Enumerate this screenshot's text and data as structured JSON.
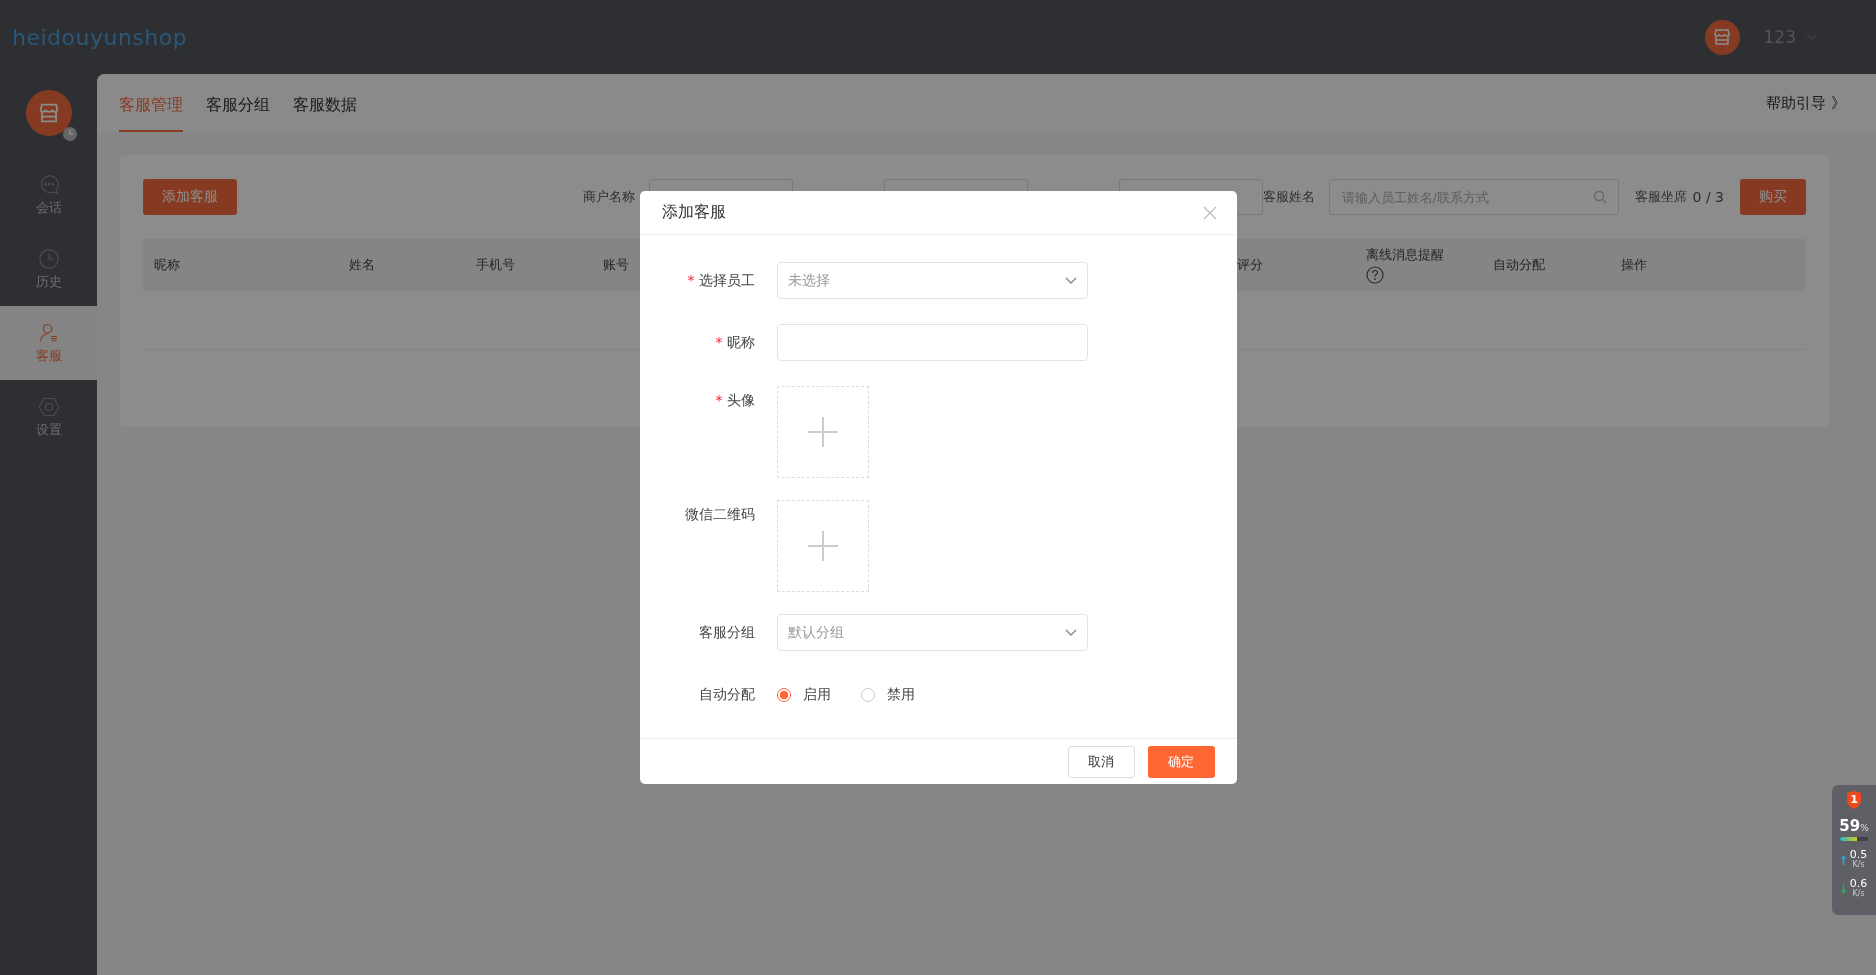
{
  "header": {
    "logo": "heidouyunshop",
    "user": "123"
  },
  "sidebar": [
    {
      "label": "会话",
      "selected": false
    },
    {
      "label": "历史",
      "selected": false
    },
    {
      "label": "客服",
      "selected": true
    },
    {
      "label": "设置",
      "selected": false
    }
  ],
  "tabs": [
    {
      "label": "客服管理",
      "selected": true
    },
    {
      "label": "客服分组",
      "selected": false
    },
    {
      "label": "客服数据",
      "selected": false
    }
  ],
  "help_link": "帮助引导 》",
  "toolbar": {
    "add_button": "添加客服",
    "merchant_label": "商户名称",
    "name_label": "客服姓名",
    "search_placeholder": "请输入员工姓名/联系方式",
    "seats_label": "客服坐席",
    "seats_count": "0 / 3",
    "buy_button": "购买"
  },
  "table": {
    "columns": [
      {
        "label": "昵称",
        "help": false
      },
      {
        "label": "姓名",
        "help": false
      },
      {
        "label": "手机号",
        "help": false
      },
      {
        "label": "账号",
        "help": false
      },
      {
        "label": "评分",
        "help": false
      },
      {
        "label": "离线消息提醒",
        "help": true
      },
      {
        "label": "自动分配",
        "help": false
      },
      {
        "label": "操作",
        "help": false
      }
    ]
  },
  "dialog": {
    "title": "添加客服",
    "fields": [
      {
        "kind": "select",
        "required_mark": "*",
        "label": "选择员工",
        "placeholder": "未选择"
      },
      {
        "kind": "text",
        "required_mark": "*",
        "label": "昵称"
      },
      {
        "kind": "upload",
        "required_mark": "*",
        "label": "头像"
      },
      {
        "kind": "upload",
        "label": "微信二维码"
      },
      {
        "kind": "select",
        "label": "客服分组",
        "placeholder": "默认分组"
      },
      {
        "kind": "radio",
        "label": "自动分配",
        "options": [
          {
            "label": "启用",
            "selected": true
          },
          {
            "label": "禁用",
            "selected": false
          }
        ]
      }
    ],
    "cancel": "取消",
    "confirm": "确定"
  },
  "monitor": {
    "alerts": "1",
    "percent": "59",
    "percent_unit": "%",
    "level": 0.59,
    "upload": "0.5",
    "upload_unit": "K/s",
    "download": "0.6",
    "download_unit": "K/s"
  }
}
